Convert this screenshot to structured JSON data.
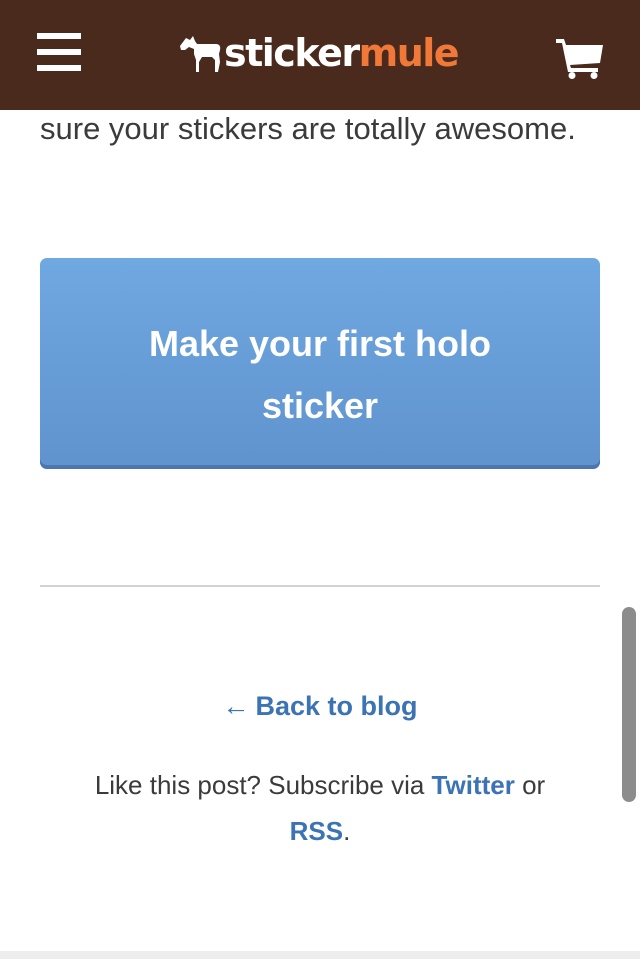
{
  "header": {
    "menu_icon": "hamburger-icon",
    "logo": {
      "icon": "mule-icon",
      "sticker": "sticker",
      "mule": "mule"
    },
    "cart_icon": "shopping-cart-icon",
    "colors": {
      "background": "#4a2a1c",
      "logo_accent": "#f0793a"
    }
  },
  "main": {
    "intro_text": "sure your stickers are totally awesome.",
    "cta_button": {
      "label": "Make your first holo sticker",
      "color": "#6a9fd9"
    }
  },
  "footer": {
    "back_link": {
      "arrow": "←",
      "label": "Back to blog"
    },
    "subscribe": {
      "prefix": "Like this post? Subscribe via ",
      "twitter_label": "Twitter",
      "middle": " or ",
      "rss_label": "RSS",
      "suffix": "."
    },
    "link_color": "#3b73b5"
  }
}
